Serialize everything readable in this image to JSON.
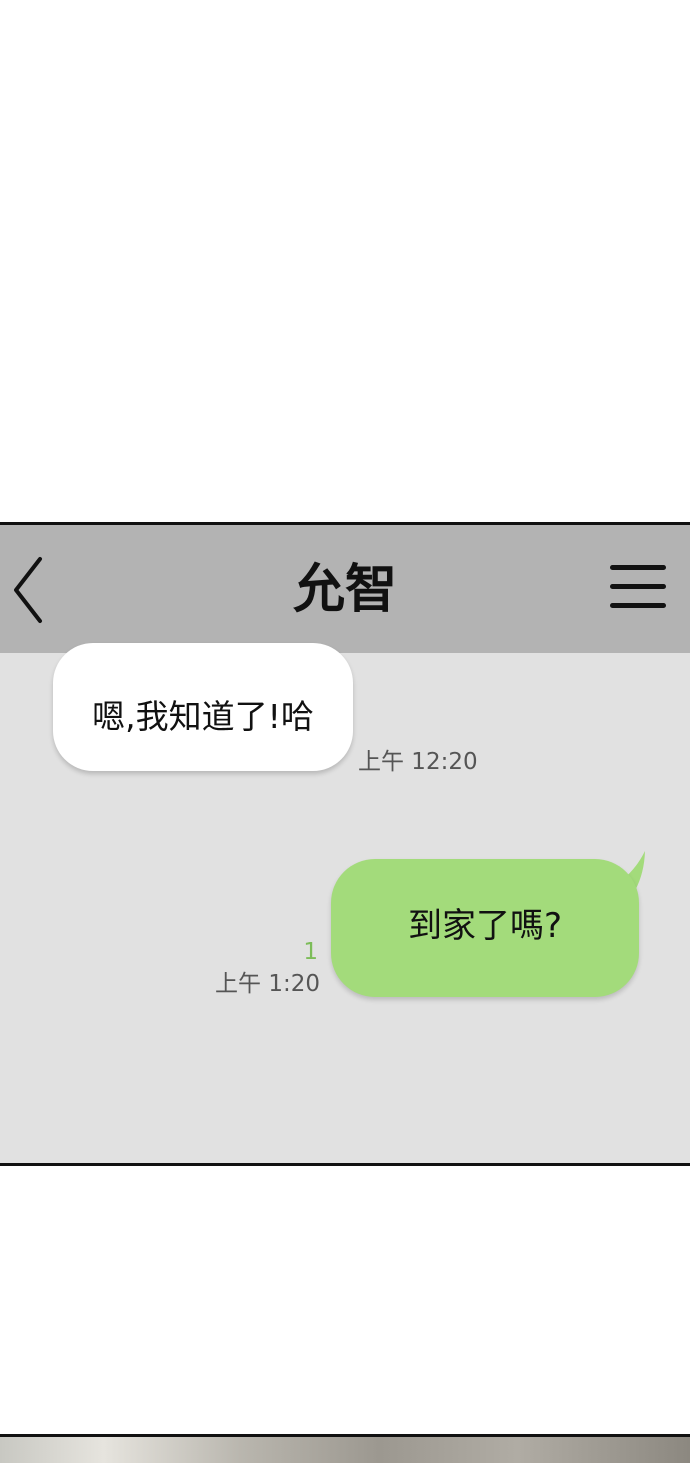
{
  "chat": {
    "contact_name": "允智",
    "back_icon": "chevron-left-icon",
    "menu_icon": "hamburger-menu-icon"
  },
  "messages": [
    {
      "direction": "incoming",
      "text": "嗯,我知道了!哈",
      "time": "上午 12:20"
    },
    {
      "direction": "outgoing",
      "text": "到家了嗎?",
      "unread_count": "1",
      "time": "上午 1:20"
    }
  ],
  "colors": {
    "header_bg": "#b3b3b3",
    "chat_bg": "#e1e1e1",
    "incoming_bubble": "#ffffff",
    "outgoing_bubble": "#a3db7b",
    "unread_count": "#7cbc58"
  }
}
